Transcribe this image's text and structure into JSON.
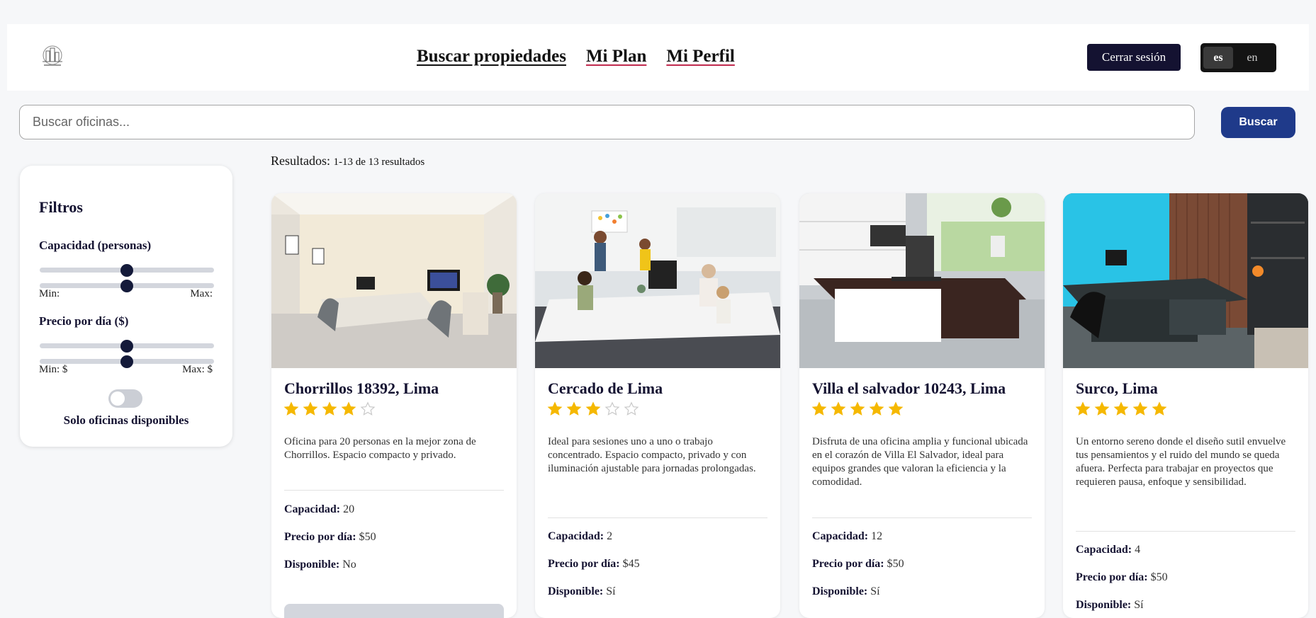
{
  "header": {
    "nav": [
      "Buscar propiedades",
      "Mi Plan",
      "Mi Perfil"
    ],
    "logout_label": "Cerrar sesión",
    "languages": [
      "es",
      "en"
    ],
    "selected_language": "es"
  },
  "search": {
    "placeholder": "Buscar oficinas...",
    "button_label": "Buscar"
  },
  "results": {
    "label": "Resultados:",
    "range": "1-13 de 13 resultados"
  },
  "filters": {
    "title": "Filtros",
    "capacity": {
      "label": "Capacidad (personas)",
      "min_label": "Min:",
      "max_label": "Max:"
    },
    "price": {
      "label": "Precio por día ($)",
      "min_label": "Min: $",
      "max_label": "Max: $"
    },
    "available_only": {
      "label": "Solo oficinas disponibles",
      "checked": false
    }
  },
  "property_labels": {
    "capacity": "Capacidad:",
    "price": "Precio por día:",
    "available": "Disponible:"
  },
  "cards": [
    {
      "title": "Chorrillos 18392, Lima",
      "rating": 4,
      "description": "Oficina para 20 personas en la mejor zona de Chorrillos. Espacio compacto y privado.",
      "capacity": "20",
      "price": "$50",
      "available": "No"
    },
    {
      "title": "Cercado de Lima",
      "rating": 3,
      "description": "Ideal para sesiones uno a uno o trabajo concentrado. Espacio compacto, privado y con iluminación ajustable para jornadas prolongadas.",
      "capacity": "2",
      "price": "$45",
      "available": "Sí"
    },
    {
      "title": "Villa el salvador 10243, Lima",
      "rating": 5,
      "description": "Disfruta de una oficina amplia y funcional ubicada en el corazón de Villa El Salvador, ideal para equipos grandes que valoran la eficiencia y la comodidad.",
      "capacity": "12",
      "price": "$50",
      "available": "Sí"
    },
    {
      "title": "Surco, Lima",
      "rating": 5,
      "description": "Un entorno sereno donde el diseño sutil envuelve tus pensamientos y el ruido del mundo se queda afuera. Perfecta para trabajar en proyectos que requieren pausa, enfoque y sensibilidad.",
      "capacity": "4",
      "price": "$50",
      "available": "Sí"
    }
  ],
  "colors": {
    "primary": "#141231",
    "accent": "#1f3a8a",
    "star": "#f5b800"
  }
}
